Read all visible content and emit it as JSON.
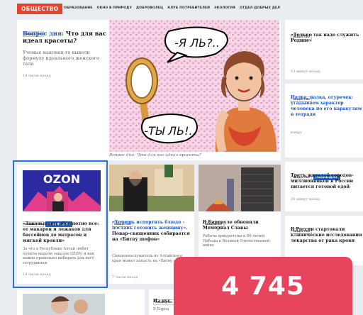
{
  "header": {
    "section": "ОБЩЕСТВО",
    "nav": [
      "ОБРАЗОВАНИЕ",
      "ОКНО В ПРИРОДУ",
      "ДОБРОВОЛЕЦ",
      "КЛУБ ПОТРЕБИТЕЛЕЙ",
      "ЭКОЛОГИЯ",
      "ОТДЕЛ ДОБРЫХ ДЕЛ"
    ]
  },
  "feature": {
    "tag": "ОБЩЕСТВО",
    "title_prefix": "Вопрос дня:",
    "title_rest": " Что для вас идеал красоты?",
    "lead": "Ученые наконец-то вывели формулу идеального женского тела",
    "time": "10 часов назад",
    "caption": "Вопрос дня: Что для вас идеал красоты?",
    "bubble1": "-Я ЛЬ?..",
    "bubble2": "-ТЫ ЛЬ!.."
  },
  "right": [
    {
      "tags": [
        "ОБЩЕСТВО"
      ],
      "title": "«Только так надо служить Родине»",
      "time": "13 минут назад"
    },
    {
      "tags": [
        "ОБЩЕСТВО"
      ],
      "title": "Палка, палка, огуречек: угадываем характер человека по его каракулям в тетради",
      "time": "вчера"
    },
    {
      "tags": [
        "ОБЩЕСТВО",
        "РЕКОМЕНДУЕМ"
      ],
      "title": "Третъ жителей городов-миллионников в России питается готовой едой",
      "time": "16 минут назад"
    },
    {
      "tags": [
        "ОБЩЕСТВО"
      ],
      "title": "В России стартовали клинические исследования лекарства от рака крови",
      "time": ""
    }
  ],
  "row2": [
    {
      "tags": [
        "ОБЩЕСТВО",
        "РЕКОМЕНДУЕМ"
      ],
      "title": "«Заказывают абсолютно все: от макарон и лежаков для бассейнов до матрасов и мягкой кровли»",
      "lead": "За что в Республике Алтай любят пункты выдачи заказов OZON, и как важно правильно выбирать для него сотрудников",
      "time": "10 часов назад",
      "image_text": "OZON"
    },
    {
      "tags": [
        "ОБЩЕСТВО"
      ],
      "title_blue": "«Хочешь испортить блюдо – поставь готовить женщину».",
      "title_rest": " Повар-священник собирается на «Битву шефов»",
      "lead": "Священнослужитель из Алтайского края может попасть на «Битву шефов»",
      "time": "7 часов назад"
    },
    {
      "tags": [
        "ОБЩЕСТВО"
      ],
      "title": "В Барнауле обновили Мемориал Славы",
      "lead": "Работы приурочены к 80-летию Победы в Великой Отечественной войне",
      "time": ""
    }
  ],
  "row3": {
    "tags": [
      "ОБЩЕСТВО"
    ],
    "title": "Из пус",
    "lead": "В Барна"
  },
  "counter": "4 745"
}
